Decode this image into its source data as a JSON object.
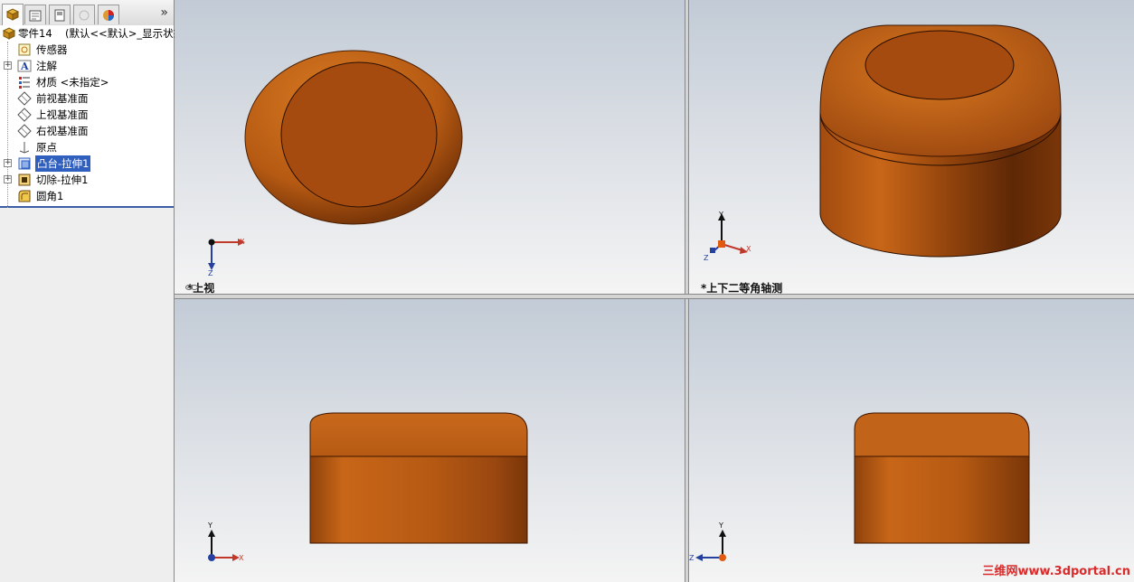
{
  "tree": {
    "root_name": "零件14",
    "root_config": "(默认<<默认>_显示状态",
    "items": [
      {
        "label": "传感器",
        "expandable": false
      },
      {
        "label": "注解",
        "expandable": true
      },
      {
        "label": "材质 <未指定>",
        "expandable": false
      },
      {
        "label": "前视基准面",
        "expandable": false
      },
      {
        "label": "上视基准面",
        "expandable": false
      },
      {
        "label": "右视基准面",
        "expandable": false
      },
      {
        "label": "原点",
        "expandable": false
      },
      {
        "label": "凸台-拉伸1",
        "expandable": true,
        "selected": true
      },
      {
        "label": "切除-拉伸1",
        "expandable": true
      },
      {
        "label": "圆角1",
        "expandable": false
      }
    ]
  },
  "tabs": {
    "more": "»"
  },
  "viewports": {
    "top_left": {
      "name": "*上视",
      "axis_x": "X",
      "axis_z": "Z"
    },
    "top_right": {
      "name": "*上下二等角轴测",
      "axis_x": "X",
      "axis_y": "Y",
      "axis_z": "Z"
    },
    "bottom_left": {
      "axis_x": "X",
      "axis_y": "Y"
    },
    "bottom_right": {
      "axis_z": "Z",
      "axis_y": "Y"
    }
  },
  "watermark": "三维网www.3dportal.cn",
  "colors": {
    "part": "#b65a13",
    "part_dark": "#6a2e08",
    "selection": "#2f5fbf",
    "watermark": "#d92b2b"
  }
}
